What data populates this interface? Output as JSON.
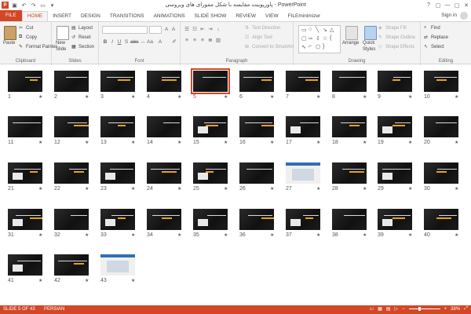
{
  "window": {
    "title": "پاورپوینت مقایسه با شکل ممورای های ویروسی - PowerPoint",
    "app_icon": "P",
    "controls": [
      "?",
      "▢",
      "—",
      "▢",
      "✕"
    ]
  },
  "ribbon": {
    "tabs": [
      "FILE",
      "HOME",
      "INSERT",
      "DESIGN",
      "TRANSITIONS",
      "ANIMATIONS",
      "SLIDE SHOW",
      "REVIEW",
      "VIEW",
      "FILEminimizer"
    ],
    "active_tab": "HOME",
    "sign_in": "Sign in",
    "clipboard": {
      "label": "Clipboard",
      "paste": "Paste",
      "cut": "Cut",
      "copy": "Copy",
      "format_painter": "Format Painter"
    },
    "slides": {
      "label": "Slides",
      "new_slide": "New",
      "new_slide_2": "Slide",
      "layout": "Layout",
      "reset": "Reset",
      "section": "Section"
    },
    "font": {
      "label": "Font"
    },
    "paragraph": {
      "label": "Paragraph",
      "text_direction": "Text Direction",
      "align_text": "Align Text",
      "convert_smartart": "Convert to SmartArt"
    },
    "drawing": {
      "label": "Drawing",
      "arrange": "Arrange",
      "quick_styles": "Quick",
      "quick_styles_2": "Styles",
      "shape_fill": "Shape Fill",
      "shape_outline": "Shape Outline",
      "shape_effects": "Shape Effects"
    },
    "editing": {
      "label": "Editing",
      "find": "Find",
      "replace": "Replace",
      "select": "Select"
    }
  },
  "slides": [
    "1",
    "2",
    "3",
    "4",
    "5",
    "6",
    "7",
    "8",
    "9",
    "10",
    "11",
    "12",
    "13",
    "14",
    "15",
    "16",
    "17",
    "18",
    "19",
    "20",
    "21",
    "22",
    "23",
    "24",
    "25",
    "26",
    "27",
    "28",
    "29",
    "30",
    "31",
    "32",
    "33",
    "34",
    "35",
    "36",
    "37",
    "38",
    "39",
    "40",
    "41",
    "42",
    "43"
  ],
  "selected_slide": "5",
  "star_glyph": "★",
  "statusbar": {
    "slide_info": "SLIDE 5 OF 43",
    "language": "PERSIAN",
    "zoom": "38%"
  },
  "colors": {
    "accent": "#d24726",
    "ribbon_bg": "#f3f3f3"
  }
}
